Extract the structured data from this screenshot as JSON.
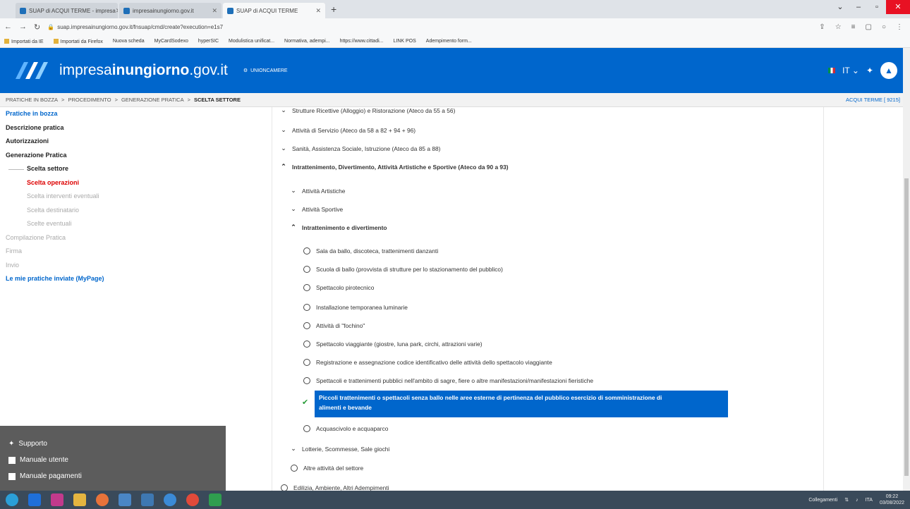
{
  "browser": {
    "tabs": [
      {
        "label": "SUAP di ACQUI TERME - impresa",
        "active": false
      },
      {
        "label": "impresainungiorno.gov.it",
        "active": false
      },
      {
        "label": "SUAP di ACQUI TERME",
        "active": true
      }
    ],
    "url": "suap.impresainungiorno.gov.it/fnsuap/cmd/create?execution=e1s7",
    "bookmarks": [
      "Importati da IE",
      "Importati da Firefox",
      "Nuova scheda",
      "MyCardSodexo",
      "hyperSIC",
      "Modulistica unificat...",
      "Normativa, adempi...",
      "https://www.cittadi...",
      "LINK POS",
      "Adempimento form..."
    ]
  },
  "header": {
    "site_prefix": "impresa",
    "site_bold": "inungiorno",
    "site_suffix": ".gov.it",
    "partner": "UNIONCAMERE",
    "lang": "IT"
  },
  "breadcrumb": {
    "items": [
      "PRATICHE IN BOZZA",
      "PROCEDIMENTO",
      "GENERAZIONE PRATICA"
    ],
    "current": "SCELTA SETTORE",
    "sep": ">",
    "office": "ACQUI TERME [ 9215]"
  },
  "sidebar": {
    "items": [
      {
        "label": "Pratiche in bozza"
      },
      {
        "label": "Descrizione pratica"
      },
      {
        "label": "Autorizzazioni"
      },
      {
        "label": "Generazione Pratica"
      },
      {
        "label": "Scelta settore"
      },
      {
        "label": "Scelta operazioni"
      },
      {
        "label": "Scelta interventi eventuali"
      },
      {
        "label": "Scelta destinatario"
      },
      {
        "label": "Scelte eventuali"
      },
      {
        "label": "Compilazione Pratica"
      },
      {
        "label": "Firma"
      },
      {
        "label": "Invio"
      },
      {
        "label": "Le mie pratiche inviate (MyPage)"
      }
    ],
    "bottom": [
      {
        "label": "Supporto"
      },
      {
        "label": "Manuale utente"
      },
      {
        "label": "Manuale pagamenti"
      }
    ]
  },
  "tree": {
    "rows": [
      {
        "label": "Strutture Ricettive (Alloggio) e Ristorazione (Ateco da 55 a 56)",
        "kind": "chevron-down"
      },
      {
        "label": "Attività di Servizio (Ateco da 58 a 82 + 94 + 96)",
        "kind": "chevron-down"
      },
      {
        "label": "Sanità, Assistenza Sociale, Istruzione (Ateco da 85 a 88)",
        "kind": "chevron-down"
      },
      {
        "label": "Intrattenimento, Divertimento, Attività Artistiche e Sportive (Ateco da 90 a 93)",
        "kind": "chevron-up"
      },
      {
        "label": "Attività Artistiche",
        "kind": "chevron-down"
      },
      {
        "label": "Attività Sportive",
        "kind": "chevron-down"
      },
      {
        "label": "Intrattenimento e divertimento",
        "kind": "chevron-up"
      },
      {
        "label": "Sala da ballo, discoteca, trattenimenti danzanti",
        "kind": "radio"
      },
      {
        "label": "Scuola di ballo (provvista di strutture per lo stazionamento del pubblico)",
        "kind": "radio"
      },
      {
        "label": "Spettacolo pirotecnico",
        "kind": "radio"
      },
      {
        "label": "Installazione temporanea luminarie",
        "kind": "radio"
      },
      {
        "label": "Attività di \"fochino\"",
        "kind": "radio"
      },
      {
        "label": "Spettacolo viaggiante (giostre, luna park, circhi, attrazioni varie)",
        "kind": "radio"
      },
      {
        "label": "Registrazione e assegnazione codice identificativo delle attività dello spettacolo viaggiante",
        "kind": "radio"
      },
      {
        "label": "Spettacoli e trattenimenti pubblici nell'ambito di sagre, fiere o altre manifestazioni/manifestazioni fieristiche",
        "kind": "radio"
      },
      {
        "label": "Acquascivolo e acquaparco",
        "kind": "radio"
      },
      {
        "label": "Lotterie, Scommesse, Sale giochi",
        "kind": "chevron-down"
      },
      {
        "label": "Altre attività del settore",
        "kind": "radio"
      },
      {
        "label": "Edilizia, Ambiente, Altri Adempimenti",
        "kind": "radio"
      }
    ],
    "selected": {
      "line1": "Piccoli trattenimenti o spettacoli senza ballo nelle aree esterne di pertinenza del pubblico esercizio di somministrazione di",
      "line2": "alimenti e bevande"
    }
  },
  "taskbar": {
    "tray_label": "Collegamenti",
    "lang": "ITA",
    "time": "09:22",
    "date": "03/08/2022"
  },
  "colors": {
    "brand": "#0066cc",
    "active_step": "#dd0000",
    "check": "#2a9d3a"
  }
}
